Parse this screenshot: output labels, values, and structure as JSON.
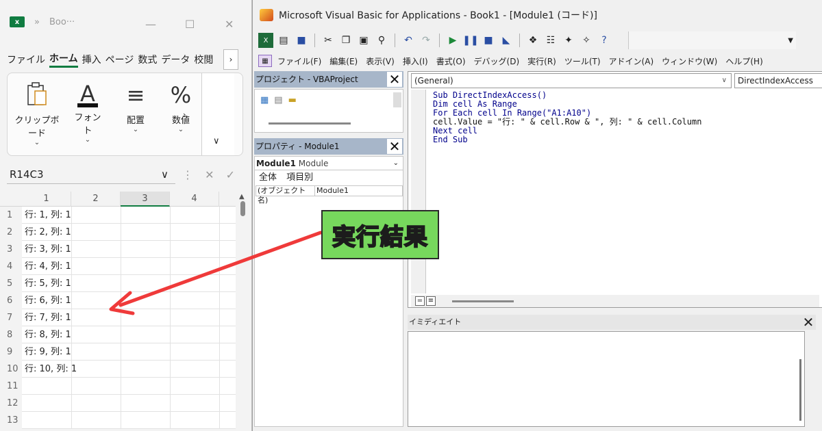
{
  "excel": {
    "title": "Boo···",
    "logo": "x",
    "nav_chevrons": "»",
    "window_controls": [
      "—",
      "☐",
      "✕"
    ],
    "menu_tabs": [
      "ファイル",
      "ホーム",
      "挿入",
      "ページ",
      "数式",
      "データ",
      "校閲"
    ],
    "menu_more": "›",
    "ribbon_groups": [
      {
        "label": "クリップボード",
        "icon": "clipboard-icon"
      },
      {
        "label": "フォント",
        "icon": "font-icon",
        "glyph": "A"
      },
      {
        "label": "配置",
        "icon": "align-icon",
        "glyph": "≡"
      },
      {
        "label": "数値",
        "icon": "percent-icon",
        "glyph": "%"
      }
    ],
    "ribbon_more": "›",
    "ribbon_expand": "∨",
    "name_box": "R14C3",
    "name_box_dropdown": "∨",
    "formula_icons": "⋮ ✕ ✓",
    "columns": [
      "1",
      "2",
      "3",
      "4"
    ],
    "rows": [
      {
        "num": "1",
        "value": "行: 1, 列: 1"
      },
      {
        "num": "2",
        "value": "行: 2, 列: 1"
      },
      {
        "num": "3",
        "value": "行: 3, 列: 1"
      },
      {
        "num": "4",
        "value": "行: 4, 列: 1"
      },
      {
        "num": "5",
        "value": "行: 5, 列: 1"
      },
      {
        "num": "6",
        "value": "行: 6, 列: 1"
      },
      {
        "num": "7",
        "value": "行: 7, 列: 1"
      },
      {
        "num": "8",
        "value": "行: 8, 列: 1"
      },
      {
        "num": "9",
        "value": "行: 9, 列: 1"
      },
      {
        "num": "10",
        "value": "行: 10, 列: 1"
      },
      {
        "num": "11",
        "value": ""
      },
      {
        "num": "12",
        "value": ""
      },
      {
        "num": "13",
        "value": ""
      }
    ]
  },
  "vbe": {
    "title": "Microsoft Visual Basic for Applications - Book1 - [Module1 (コード)]",
    "menu": [
      "ファイル(F)",
      "編集(E)",
      "表示(V)",
      "挿入(I)",
      "書式(O)",
      "デバッグ(D)",
      "実行(R)",
      "ツール(T)",
      "アドイン(A)",
      "ウィンドウ(W)",
      "ヘルプ(H)"
    ],
    "project_pane_title": "プロジェクト - VBAProject",
    "properties_pane_title": "プロパティ - Module1",
    "properties_object": "Module1",
    "properties_object_type": "Module",
    "properties_tabs": [
      "全体",
      "項目別"
    ],
    "properties_rows": [
      {
        "key": "(オブジェクト名)",
        "value": "Module1"
      }
    ],
    "object_combo": "(General)",
    "procedure_combo": "DirectIndexAccess",
    "code_lines": [
      "Sub DirectIndexAccess()",
      "Dim cell As Range",
      "For Each cell In Range(\"A1:A10\")",
      "cell.Value = \"行: \" & cell.Row & \", 列: \" & cell.Column",
      "Next cell",
      "End Sub"
    ],
    "immediate_title": "イミディエイト"
  },
  "annotation": {
    "label": "実行結果",
    "box_color": "#77d85d",
    "arrow_color": "#ef3a3a"
  },
  "colors": {
    "excel_accent": "#107c41",
    "pane_title_bg": "#a7b6c9",
    "code_keyword": "#00008b"
  }
}
